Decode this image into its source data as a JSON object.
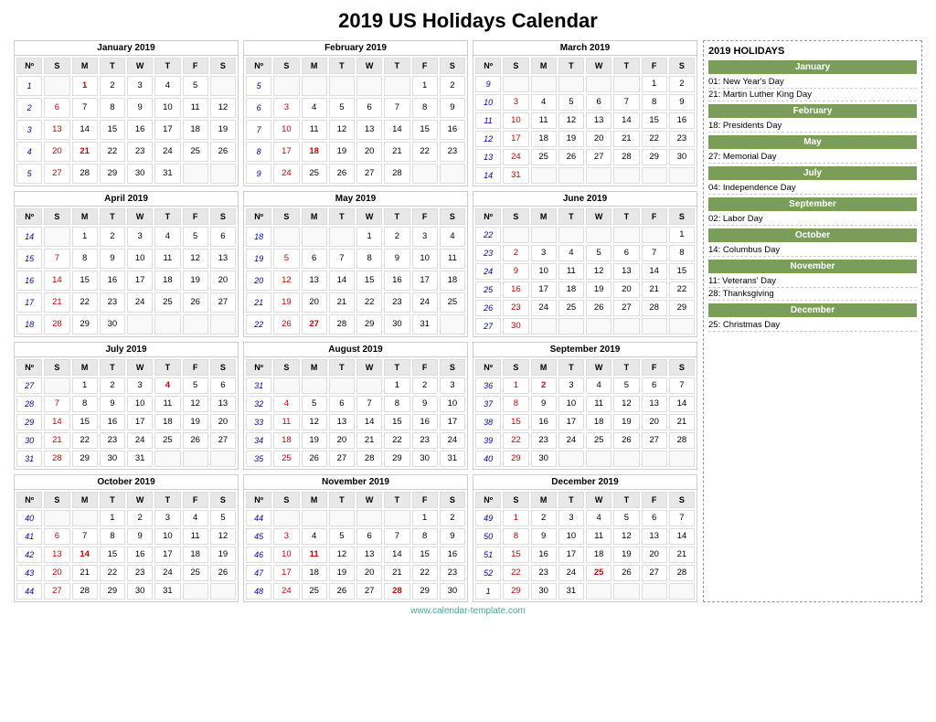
{
  "title": "2019 US Holidays Calendar",
  "footer": "www.calendar-template.com",
  "sidebar": {
    "title": "2019 HOLIDAYS",
    "sections": [
      {
        "month": "January",
        "holidays": [
          "01: New Year's Day",
          "21: Martin Luther King Day"
        ]
      },
      {
        "month": "February",
        "holidays": [
          "18: Presidents Day"
        ]
      },
      {
        "month": "May",
        "holidays": [
          "27: Memorial Day"
        ]
      },
      {
        "month": "July",
        "holidays": [
          "04: Independence Day"
        ]
      },
      {
        "month": "September",
        "holidays": [
          "02: Labor Day"
        ]
      },
      {
        "month": "October",
        "holidays": [
          "14: Columbus Day"
        ]
      },
      {
        "month": "November",
        "holidays": [
          "11: Veterans' Day",
          "28: Thanksgiving"
        ]
      },
      {
        "month": "December",
        "holidays": [
          "25: Christmas Day"
        ]
      }
    ]
  },
  "months": [
    {
      "name": "January 2019",
      "weeks": [
        {
          "wn": "1",
          "days": [
            "",
            "1",
            "2",
            "3",
            "4",
            "5",
            ""
          ]
        },
        {
          "wn": "2",
          "days": [
            "6",
            "7",
            "8",
            "9",
            "10",
            "11",
            "12"
          ]
        },
        {
          "wn": "3",
          "days": [
            "13",
            "14",
            "15",
            "16",
            "17",
            "18",
            "19"
          ]
        },
        {
          "wn": "4",
          "days": [
            "20",
            "21",
            "22",
            "23",
            "24",
            "25",
            "26"
          ]
        },
        {
          "wn": "5",
          "days": [
            "27",
            "28",
            "29",
            "30",
            "31",
            "",
            ""
          ]
        }
      ],
      "holidays": [
        "1",
        "21"
      ]
    },
    {
      "name": "February 2019",
      "weeks": [
        {
          "wn": "5",
          "days": [
            "",
            "",
            "",
            "",
            "",
            "1",
            "2"
          ]
        },
        {
          "wn": "6",
          "days": [
            "3",
            "4",
            "5",
            "6",
            "7",
            "8",
            "9"
          ]
        },
        {
          "wn": "7",
          "days": [
            "10",
            "11",
            "12",
            "13",
            "14",
            "15",
            "16"
          ]
        },
        {
          "wn": "8",
          "days": [
            "17",
            "18",
            "19",
            "20",
            "21",
            "22",
            "23"
          ]
        },
        {
          "wn": "9",
          "days": [
            "24",
            "25",
            "26",
            "27",
            "28",
            "",
            ""
          ]
        }
      ],
      "holidays": [
        "18"
      ]
    },
    {
      "name": "March 2019",
      "weeks": [
        {
          "wn": "9",
          "days": [
            "",
            "",
            "",
            "",
            "",
            "1",
            "2"
          ]
        },
        {
          "wn": "10",
          "days": [
            "3",
            "4",
            "5",
            "6",
            "7",
            "8",
            "9"
          ]
        },
        {
          "wn": "11",
          "days": [
            "10",
            "11",
            "12",
            "13",
            "14",
            "15",
            "16"
          ]
        },
        {
          "wn": "12",
          "days": [
            "17",
            "18",
            "19",
            "20",
            "21",
            "22",
            "23"
          ]
        },
        {
          "wn": "13",
          "days": [
            "24",
            "25",
            "26",
            "27",
            "28",
            "29",
            "30"
          ]
        },
        {
          "wn": "14",
          "days": [
            "31",
            "",
            "",
            "",
            "",
            "",
            ""
          ]
        }
      ],
      "holidays": []
    },
    {
      "name": "April 2019",
      "weeks": [
        {
          "wn": "14",
          "days": [
            "",
            "1",
            "2",
            "3",
            "4",
            "5",
            "6"
          ]
        },
        {
          "wn": "15",
          "days": [
            "7",
            "8",
            "9",
            "10",
            "11",
            "12",
            "13"
          ]
        },
        {
          "wn": "16",
          "days": [
            "14",
            "15",
            "16",
            "17",
            "18",
            "19",
            "20"
          ]
        },
        {
          "wn": "17",
          "days": [
            "21",
            "22",
            "23",
            "24",
            "25",
            "26",
            "27"
          ]
        },
        {
          "wn": "18",
          "days": [
            "28",
            "29",
            "30",
            "",
            "",
            "",
            ""
          ]
        }
      ],
      "holidays": []
    },
    {
      "name": "May 2019",
      "weeks": [
        {
          "wn": "18",
          "days": [
            "",
            "",
            "",
            "1",
            "2",
            "3",
            "4"
          ]
        },
        {
          "wn": "19",
          "days": [
            "5",
            "6",
            "7",
            "8",
            "9",
            "10",
            "11"
          ]
        },
        {
          "wn": "20",
          "days": [
            "12",
            "13",
            "14",
            "15",
            "16",
            "17",
            "18"
          ]
        },
        {
          "wn": "21",
          "days": [
            "19",
            "20",
            "21",
            "22",
            "23",
            "24",
            "25"
          ]
        },
        {
          "wn": "22",
          "days": [
            "26",
            "27",
            "28",
            "29",
            "30",
            "31",
            ""
          ]
        }
      ],
      "holidays": [
        "27"
      ]
    },
    {
      "name": "June 2019",
      "weeks": [
        {
          "wn": "22",
          "days": [
            "",
            "",
            "",
            "",
            "",
            "",
            "1"
          ]
        },
        {
          "wn": "23",
          "days": [
            "2",
            "3",
            "4",
            "5",
            "6",
            "7",
            "8"
          ]
        },
        {
          "wn": "24",
          "days": [
            "9",
            "10",
            "11",
            "12",
            "13",
            "14",
            "15"
          ]
        },
        {
          "wn": "25",
          "days": [
            "16",
            "17",
            "18",
            "19",
            "20",
            "21",
            "22"
          ]
        },
        {
          "wn": "26",
          "days": [
            "23",
            "24",
            "25",
            "26",
            "27",
            "28",
            "29"
          ]
        },
        {
          "wn": "27",
          "days": [
            "30",
            "",
            "",
            "",
            "",
            "",
            ""
          ]
        }
      ],
      "holidays": []
    },
    {
      "name": "July 2019",
      "weeks": [
        {
          "wn": "27",
          "days": [
            "",
            "1",
            "2",
            "3",
            "4",
            "5",
            "6"
          ]
        },
        {
          "wn": "28",
          "days": [
            "7",
            "8",
            "9",
            "10",
            "11",
            "12",
            "13"
          ]
        },
        {
          "wn": "29",
          "days": [
            "14",
            "15",
            "16",
            "17",
            "18",
            "19",
            "20"
          ]
        },
        {
          "wn": "30",
          "days": [
            "21",
            "22",
            "23",
            "24",
            "25",
            "26",
            "27"
          ]
        },
        {
          "wn": "31",
          "days": [
            "28",
            "29",
            "30",
            "31",
            "",
            "",
            ""
          ]
        }
      ],
      "holidays": [
        "4"
      ]
    },
    {
      "name": "August 2019",
      "weeks": [
        {
          "wn": "31",
          "days": [
            "",
            "",
            "",
            "",
            "1",
            "2",
            "3"
          ]
        },
        {
          "wn": "32",
          "days": [
            "4",
            "5",
            "6",
            "7",
            "8",
            "9",
            "10"
          ]
        },
        {
          "wn": "33",
          "days": [
            "11",
            "12",
            "13",
            "14",
            "15",
            "16",
            "17"
          ]
        },
        {
          "wn": "34",
          "days": [
            "18",
            "19",
            "20",
            "21",
            "22",
            "23",
            "24"
          ]
        },
        {
          "wn": "35",
          "days": [
            "25",
            "26",
            "27",
            "28",
            "29",
            "30",
            "31"
          ]
        }
      ],
      "holidays": []
    },
    {
      "name": "September 2019",
      "weeks": [
        {
          "wn": "36",
          "days": [
            "1",
            "2",
            "3",
            "4",
            "5",
            "6",
            "7"
          ]
        },
        {
          "wn": "37",
          "days": [
            "8",
            "9",
            "10",
            "11",
            "12",
            "13",
            "14"
          ]
        },
        {
          "wn": "38",
          "days": [
            "15",
            "16",
            "17",
            "18",
            "19",
            "20",
            "21"
          ]
        },
        {
          "wn": "39",
          "days": [
            "22",
            "23",
            "24",
            "25",
            "26",
            "27",
            "28"
          ]
        },
        {
          "wn": "40",
          "days": [
            "29",
            "30",
            "",
            "",
            "",
            "",
            ""
          ]
        }
      ],
      "holidays": [
        "2"
      ]
    },
    {
      "name": "October 2019",
      "weeks": [
        {
          "wn": "40",
          "days": [
            "",
            "",
            "1",
            "2",
            "3",
            "4",
            "5"
          ]
        },
        {
          "wn": "41",
          "days": [
            "6",
            "7",
            "8",
            "9",
            "10",
            "11",
            "12"
          ]
        },
        {
          "wn": "42",
          "days": [
            "13",
            "14",
            "15",
            "16",
            "17",
            "18",
            "19"
          ]
        },
        {
          "wn": "43",
          "days": [
            "20",
            "21",
            "22",
            "23",
            "24",
            "25",
            "26"
          ]
        },
        {
          "wn": "44",
          "days": [
            "27",
            "28",
            "29",
            "30",
            "31",
            "",
            ""
          ]
        }
      ],
      "holidays": [
        "14"
      ]
    },
    {
      "name": "November 2019",
      "weeks": [
        {
          "wn": "44",
          "days": [
            "",
            "",
            "",
            "",
            "",
            "1",
            "2"
          ]
        },
        {
          "wn": "45",
          "days": [
            "3",
            "4",
            "5",
            "6",
            "7",
            "8",
            "9"
          ]
        },
        {
          "wn": "46",
          "days": [
            "10",
            "11",
            "12",
            "13",
            "14",
            "15",
            "16"
          ]
        },
        {
          "wn": "47",
          "days": [
            "17",
            "18",
            "19",
            "20",
            "21",
            "22",
            "23"
          ]
        },
        {
          "wn": "48",
          "days": [
            "24",
            "25",
            "26",
            "27",
            "28",
            "29",
            "30"
          ]
        }
      ],
      "holidays": [
        "11",
        "28"
      ]
    },
    {
      "name": "December 2019",
      "weeks": [
        {
          "wn": "49",
          "days": [
            "1",
            "2",
            "3",
            "4",
            "5",
            "6",
            "7"
          ]
        },
        {
          "wn": "50",
          "days": [
            "8",
            "9",
            "10",
            "11",
            "12",
            "13",
            "14"
          ]
        },
        {
          "wn": "51",
          "days": [
            "15",
            "16",
            "17",
            "18",
            "19",
            "20",
            "21"
          ]
        },
        {
          "wn": "52",
          "days": [
            "22",
            "23",
            "24",
            "25",
            "26",
            "27",
            "28"
          ]
        },
        {
          "wn": "1",
          "days": [
            "29",
            "30",
            "31",
            "",
            "",
            "",
            ""
          ]
        }
      ],
      "holidays": [
        "25"
      ]
    }
  ]
}
